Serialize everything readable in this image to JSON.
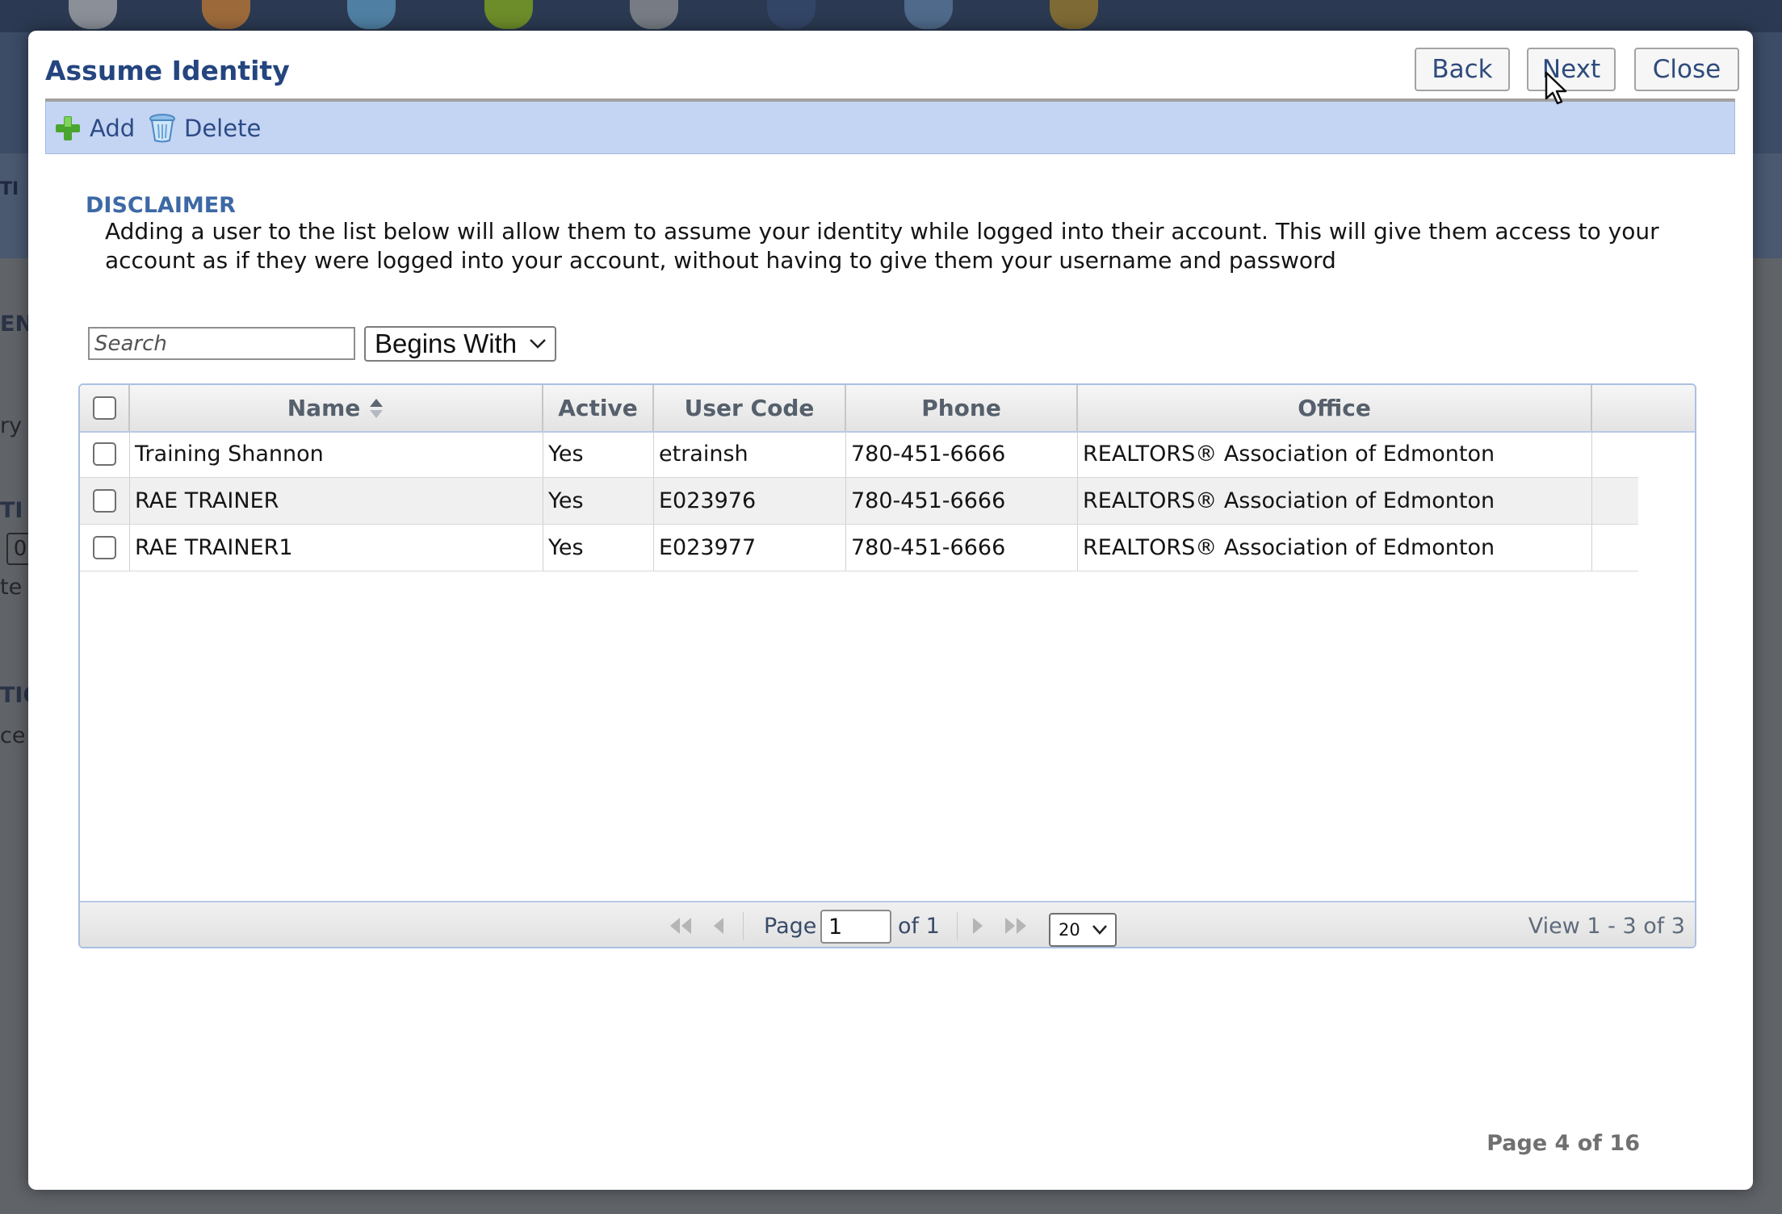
{
  "dialog": {
    "title": "Assume Identity",
    "back_label": "Back",
    "next_label": "Next",
    "close_label": "Close"
  },
  "toolbar": {
    "add_label": "Add",
    "delete_label": "Delete"
  },
  "disclaimer": {
    "heading": "DISCLAIMER",
    "text": "Adding a user to the list below will allow them to assume your identity while logged into their account. This will give them access to your account as if they were logged into your account, without having to give them your username and password"
  },
  "search": {
    "placeholder": "Search",
    "value": "",
    "match_mode": "Begins With"
  },
  "grid": {
    "columns": [
      "Name",
      "Active",
      "User Code",
      "Phone",
      "Office"
    ],
    "rows": [
      {
        "name": "Training Shannon",
        "active": "Yes",
        "user_code": "etrainsh",
        "phone": "780-451-6666",
        "office": "REALTORS® Association of Edmonton"
      },
      {
        "name": "RAE TRAINER",
        "active": "Yes",
        "user_code": "E023976",
        "phone": "780-451-6666",
        "office": "REALTORS® Association of Edmonton"
      },
      {
        "name": "RAE TRAINER1",
        "active": "Yes",
        "user_code": "E023977",
        "phone": "780-451-6666",
        "office": "REALTORS® Association of Edmonton"
      }
    ]
  },
  "pager": {
    "page_label": "Page",
    "current_page": "1",
    "of_label": "of 1",
    "page_size": "20",
    "view_text": "View 1 - 3 of 3"
  },
  "wizard": {
    "page_indicator": "Page 4 of 16"
  },
  "background": {
    "partial_texts": [
      "EN",
      "ry",
      "TI",
      "0",
      "te t",
      "TIO",
      "ce E"
    ]
  },
  "colors": {
    "title": "#24457f",
    "toolbar_bg": "#c4d4f3",
    "disclaimer_heading": "#3d69a5",
    "grid_border": "#aac0e2"
  }
}
